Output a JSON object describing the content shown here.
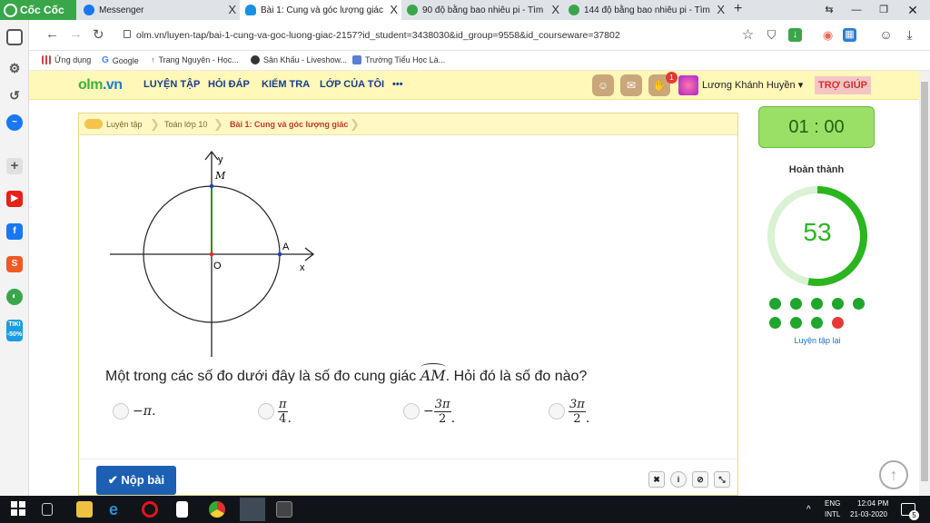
{
  "browser": {
    "brand": "Cốc Cốc",
    "tabs": [
      {
        "label": "Messenger",
        "close": "X"
      },
      {
        "label": "Bài 1: Cung và góc lượng giác",
        "close": "X"
      },
      {
        "label": "90 độ bằng bao nhiêu pi - Tìm",
        "close": "X"
      },
      {
        "label": "144 độ bằng bao nhiêu pi - Tìm",
        "close": "X"
      }
    ],
    "new_tab": "+",
    "url": "olm.vn/luyen-tap/bai-1-cung-va-goc-luong-giac-2157?id_student=3438030&id_group=9558&id_courseware=37802",
    "bookmarks": [
      "Ứng dụng",
      "Google",
      "Trang Nguyên - Học...",
      "Sân Khấu - Liveshow...",
      "Trường Tiểu Học Là..."
    ]
  },
  "site": {
    "logo_main": "olm",
    "logo_suffix": ".vn",
    "menu": [
      "LUYỆN TẬP",
      "HỎI ĐÁP",
      "KIỂM TRA",
      "LỚP CỦA TÔI",
      "•••"
    ],
    "notification_count": "1",
    "user_name": "Lương Khánh Huyền ▾",
    "help": "TRỢ GIÚP"
  },
  "breadcrumb": [
    "Luyện tập",
    "Toán lớp 10",
    "Bài 1: Cung và góc lượng giác"
  ],
  "graph": {
    "y_label": "y",
    "x_label": "x",
    "m_label": "M",
    "a_label": "A",
    "o_label": "O"
  },
  "question": {
    "text_before": "Một trong các số đo dưới đây là số đo cung giác ",
    "arc": "AM",
    "text_after": ".  Hỏi đó là số đo nào?"
  },
  "options": [
    {
      "sign": "−",
      "numer": "π",
      "denom": "",
      "tail": "."
    },
    {
      "sign": "",
      "numer": "π",
      "denom": "4",
      "tail": "."
    },
    {
      "sign": "−",
      "numer": "3π",
      "denom": "2",
      "tail": "."
    },
    {
      "sign": "",
      "numer": "3π",
      "denom": "2",
      "tail": "."
    }
  ],
  "submit_label": "✔ Nộp bài",
  "mini_buttons": [
    "✖",
    "i",
    "⊘",
    "⤡"
  ],
  "panel": {
    "timer": "01 : 00",
    "done_label": "Hoàn thành",
    "score": "53",
    "progress_fraction": 0.53,
    "result_dots": [
      "correct",
      "correct",
      "correct",
      "correct",
      "correct",
      "correct",
      "correct",
      "correct",
      "wrong"
    ],
    "retry": "Luyện tập lại"
  },
  "taskbar": {
    "lang": "ENG",
    "region": "INTL",
    "time": "12:04 PM",
    "date": "21-03-2020",
    "badge": "5"
  },
  "colors": {
    "accent_green": "#2bb51f",
    "wrong": "#e53935",
    "brand_blue": "#1d5fb3"
  }
}
